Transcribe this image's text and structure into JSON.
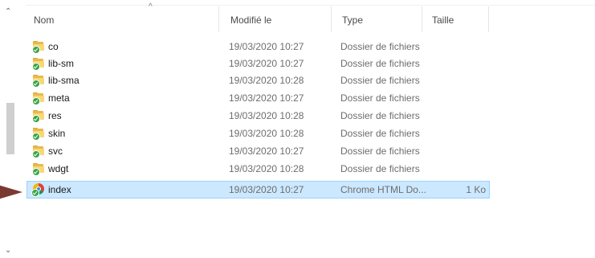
{
  "columns": {
    "name": "Nom",
    "modified": "Modifié le",
    "type": "Type",
    "size": "Taille"
  },
  "colors": {
    "selection": "#cce8ff",
    "folder": "#f8d775",
    "sync": "#3aa545"
  },
  "rows": [
    {
      "name": "co",
      "modified": "19/03/2020 10:27",
      "type": "Dossier de fichiers",
      "size": "",
      "icon": "folder-icon"
    },
    {
      "name": "lib-sm",
      "modified": "19/03/2020 10:27",
      "type": "Dossier de fichiers",
      "size": "",
      "icon": "folder-icon"
    },
    {
      "name": "lib-sma",
      "modified": "19/03/2020 10:28",
      "type": "Dossier de fichiers",
      "size": "",
      "icon": "folder-icon"
    },
    {
      "name": "meta",
      "modified": "19/03/2020 10:27",
      "type": "Dossier de fichiers",
      "size": "",
      "icon": "folder-icon"
    },
    {
      "name": "res",
      "modified": "19/03/2020 10:28",
      "type": "Dossier de fichiers",
      "size": "",
      "icon": "folder-icon"
    },
    {
      "name": "skin",
      "modified": "19/03/2020 10:28",
      "type": "Dossier de fichiers",
      "size": "",
      "icon": "folder-icon"
    },
    {
      "name": "svc",
      "modified": "19/03/2020 10:27",
      "type": "Dossier de fichiers",
      "size": "",
      "icon": "folder-icon"
    },
    {
      "name": "wdgt",
      "modified": "19/03/2020 10:28",
      "type": "Dossier de fichiers",
      "size": "",
      "icon": "folder-icon"
    },
    {
      "name": "index",
      "modified": "19/03/2020 10:27",
      "type": "Chrome HTML Do...",
      "size": "1 Ko",
      "icon": "chrome-html-icon",
      "selected": true
    }
  ]
}
